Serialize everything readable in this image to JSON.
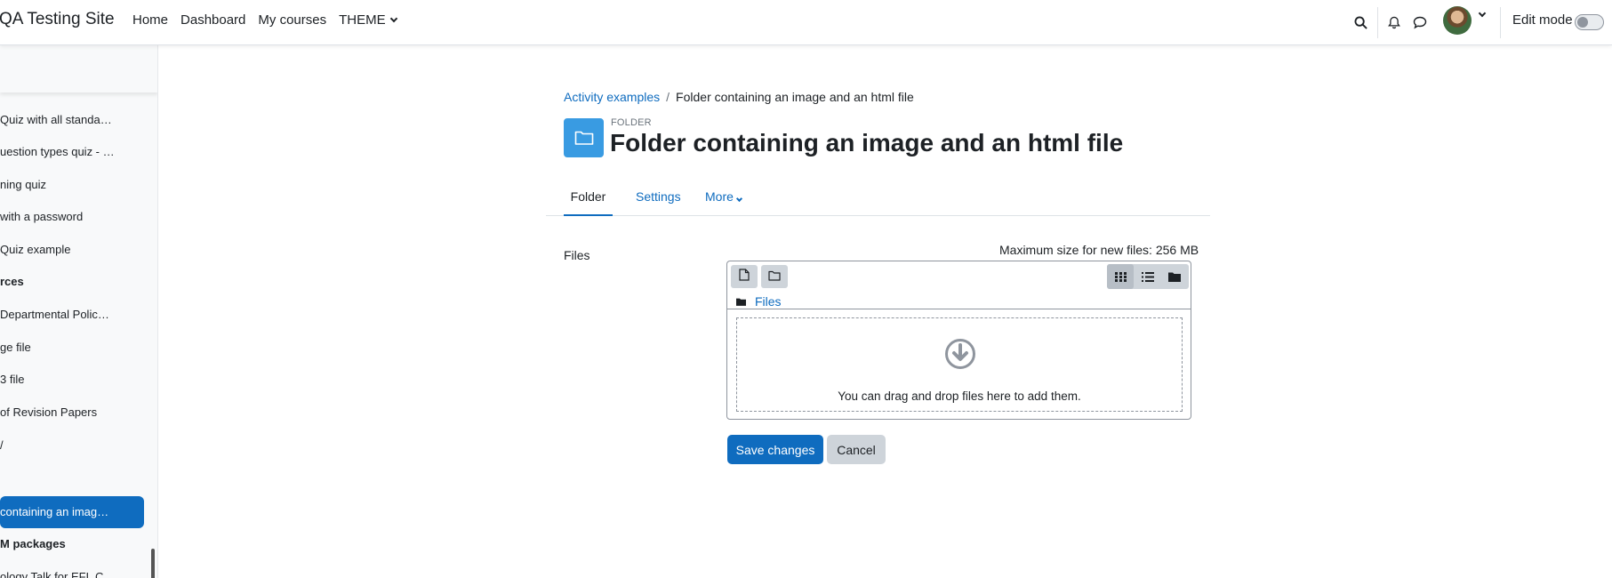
{
  "navbar": {
    "site_name": "QA Testing Site",
    "links": [
      {
        "label": "Home"
      },
      {
        "label": "Dashboard"
      },
      {
        "label": "My courses"
      },
      {
        "label": "THEME"
      }
    ],
    "edit_mode_label": "Edit mode",
    "edit_mode_on": false,
    "icons": [
      "search-icon",
      "notifications-bell-icon",
      "messages-chat-icon",
      "user-avatar",
      "chevron-down-icon"
    ]
  },
  "drawer": {
    "items": [
      {
        "label": "Quiz with all standa…",
        "section": false,
        "active": false
      },
      {
        "label": "uestion types quiz - …",
        "section": false,
        "active": false
      },
      {
        "label": "ning quiz",
        "section": false,
        "active": false
      },
      {
        "label": "with a password",
        "section": false,
        "active": false
      },
      {
        "label": "Quiz example",
        "section": false,
        "active": false
      },
      {
        "label": "rces",
        "section": true,
        "active": false
      },
      {
        "label": " Departmental Polic…",
        "section": false,
        "active": false
      },
      {
        "label": "ge file",
        "section": false,
        "active": false
      },
      {
        "label": "3 file",
        "section": false,
        "active": false
      },
      {
        "label": "of Revision Papers",
        "section": false,
        "active": false
      },
      {
        "label": "/",
        "section": false,
        "active": false
      },
      {
        "label": "containing an imag…",
        "section": false,
        "active": true
      },
      {
        "label": "M packages",
        "section": true,
        "active": false
      },
      {
        "label": "ology Talk for EFL C…",
        "section": false,
        "active": false
      }
    ]
  },
  "breadcrumb": {
    "parent": "Activity examples",
    "separator": "/",
    "current": "Folder containing an image and an html file"
  },
  "activity": {
    "type_label": "FOLDER",
    "title": "Folder containing an image and an html file",
    "icon_color": "#399be2"
  },
  "tabs": [
    {
      "label": "Folder",
      "active": true
    },
    {
      "label": "Settings",
      "active": false
    },
    {
      "label": "More",
      "active": false
    }
  ],
  "form": {
    "files_label": "Files",
    "max_size_text": "Maximum size for new files: 256 MB",
    "path_label": "Files",
    "drop_text": "You can drag and drop files here to add them.",
    "save_label": "Save changes",
    "cancel_label": "Cancel"
  },
  "colors": {
    "accent": "#0f6cbf",
    "text": "#1d2125",
    "secondary_button": "#ced4da"
  }
}
